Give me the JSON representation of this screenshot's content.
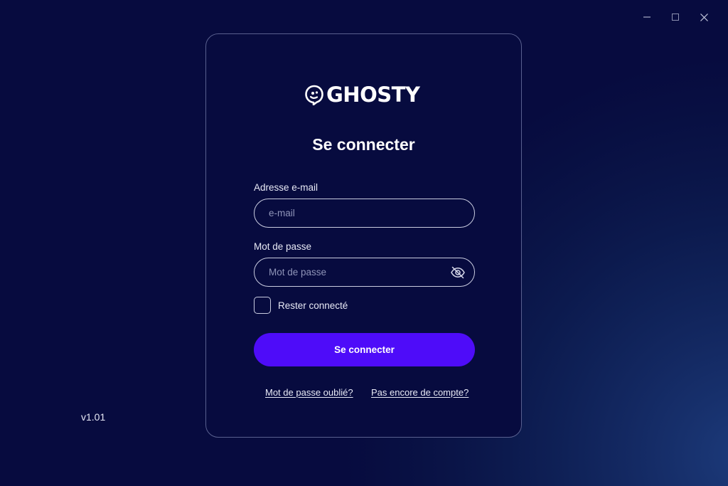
{
  "window": {
    "controls": {
      "minimize_icon": "minimize-icon",
      "maximize_icon": "maximize-icon",
      "close_icon": "close-icon"
    }
  },
  "app": {
    "name": "GHOSTY",
    "logo_icon": "ghost-icon",
    "version": "v1.01"
  },
  "login": {
    "title": "Se connecter",
    "email": {
      "label": "Adresse e-mail",
      "placeholder": "e-mail",
      "value": ""
    },
    "password": {
      "label": "Mot de passe",
      "placeholder": "Mot de passe",
      "value": "",
      "toggle_icon": "eye-off-icon"
    },
    "remember": {
      "label": "Rester connecté",
      "checked": false
    },
    "submit_label": "Se connecter",
    "forgot_link": "Mot de passe oublié?",
    "signup_link": "Pas encore de compte?"
  },
  "colors": {
    "background": "#070b3f",
    "accent": "#4e0cf9",
    "border": "#c9cce0",
    "card_border": "#59608f"
  }
}
